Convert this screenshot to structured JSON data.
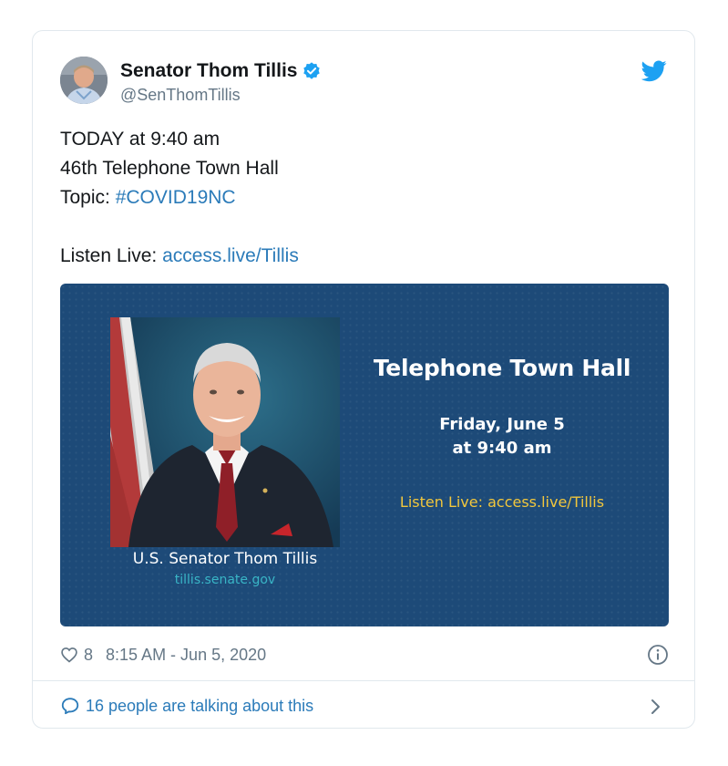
{
  "author": {
    "display_name": "Senator Thom Tillis",
    "handle": "@SenThomTillis",
    "avatar_icon": "profile-photo",
    "verified_icon": "verified-badge-icon"
  },
  "platform_icon": "twitter-bird-icon",
  "tweet": {
    "line1": "TODAY at 9:40 am",
    "line2": "46th Telephone Town Hall",
    "topic_prefix": "Topic: ",
    "hashtag": "#COVID19NC",
    "listen_prefix": "Listen Live: ",
    "listen_link": "access.live/Tillis"
  },
  "media": {
    "title": "Telephone Town Hall",
    "date_line1": "Friday, June 5",
    "date_line2": "at 9:40 am",
    "listen_text": "Listen Live: access.live/Tillis",
    "caption_name": "U.S. Senator Thom Tillis",
    "caption_site": "tillis.senate.gov"
  },
  "footer": {
    "like_count": "8",
    "timestamp": "8:15 AM - Jun 5, 2020",
    "talking": "16 people are talking about this"
  },
  "colors": {
    "link": "#2b7bb9",
    "verified": "#1da1f2",
    "media_bg": "#1d4a78",
    "listen_yellow": "#f2c73c",
    "site_teal": "#39b5c6"
  }
}
